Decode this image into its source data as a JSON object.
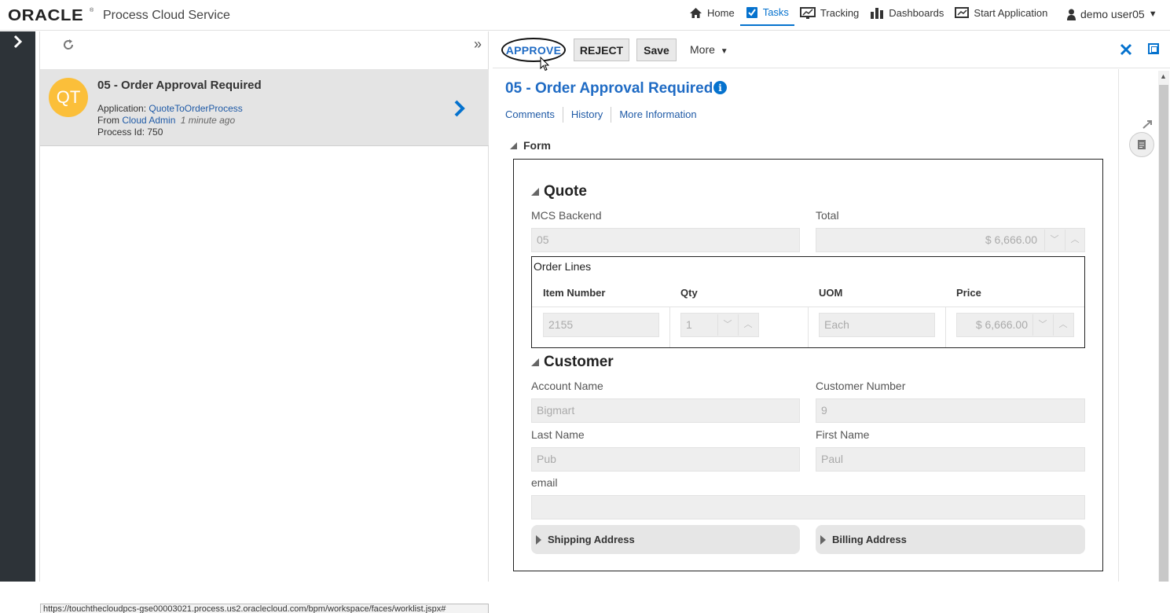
{
  "header": {
    "brand": "ORACLE",
    "reg": "®",
    "app_title": "Process Cloud Service",
    "nav": [
      {
        "label": "Home",
        "icon": "home-icon"
      },
      {
        "label": "Tasks",
        "icon": "tasks-icon",
        "active": true
      },
      {
        "label": "Tracking",
        "icon": "tracking-icon"
      },
      {
        "label": "Dashboards",
        "icon": "dashboards-icon"
      },
      {
        "label": "Start Application",
        "icon": "start-application-icon"
      }
    ],
    "user": "demo user05"
  },
  "task_list": {
    "task": {
      "avatar": "QT",
      "title": "05 - Order Approval Required",
      "application_label": "Application:",
      "application": "QuoteToOrderProcess",
      "from_label": "From",
      "from": "Cloud Admin",
      "ago": "1 minute ago",
      "process_id": "Process Id: 750"
    },
    "status_url": "https://touchthecloudpcs-gse00003021.process.us2.oraclecloud.com/bpm/workspace/faces/worklist.jspx#"
  },
  "detail": {
    "actions": {
      "approve": "APPROVE",
      "reject": "REJECT",
      "save": "Save",
      "more": "More"
    },
    "title": "05 - Order Approval Required",
    "tabs": [
      "Comments",
      "History",
      "More Information"
    ],
    "form_section": "Form",
    "quote": {
      "heading": "Quote",
      "mcs_backend_label": "MCS Backend",
      "mcs_backend_value": "05",
      "total_label": "Total",
      "total_value": "$ 6,666.00"
    },
    "order_lines": {
      "title": "Order Lines",
      "columns": [
        "Item Number",
        "Qty",
        "UOM",
        "Price"
      ],
      "row": {
        "item_number": "2155",
        "qty": "1",
        "uom": "Each",
        "price": "$ 6,666.00"
      }
    },
    "customer": {
      "heading": "Customer",
      "account_name_label": "Account Name",
      "account_name_value": "Bigmart",
      "customer_number_label": "Customer Number",
      "customer_number_value": "9",
      "last_name_label": "Last Name",
      "last_name_value": "Pub",
      "first_name_label": "First Name",
      "first_name_value": "Paul",
      "email_label": "email",
      "email_value": "",
      "shipping_address": "Shipping Address",
      "billing_address": "Billing Address"
    }
  },
  "colors": {
    "accent": "#0572ce",
    "rail": "#2d3338",
    "avatar": "#fbbf3a",
    "selected_card": "#e4e4e4"
  }
}
